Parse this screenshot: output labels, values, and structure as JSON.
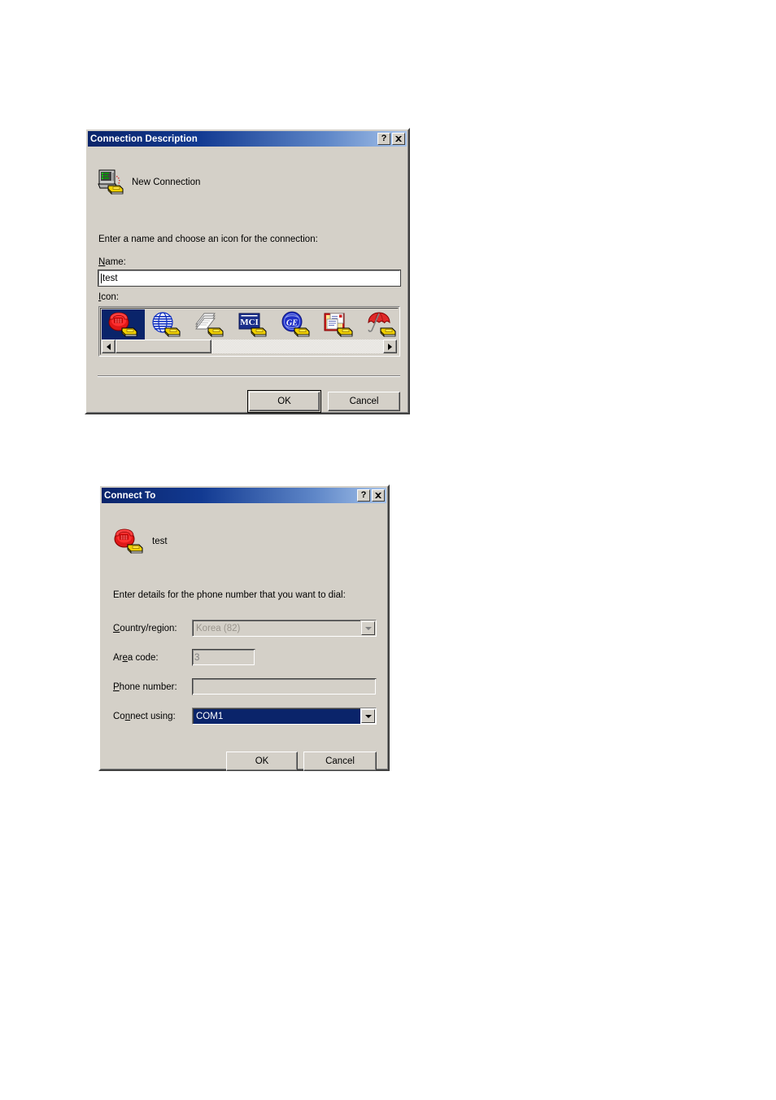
{
  "page": {
    "background": "#ffffff"
  },
  "dialogs": [
    {
      "id": "connection-description",
      "title": "Connection Description",
      "titlebar_buttons": [
        {
          "name": "help-button",
          "glyph": "?"
        },
        {
          "name": "close-button",
          "glyph": "×"
        }
      ],
      "header": {
        "icon": "new-connection-icon",
        "caption": "New Connection"
      },
      "prompt": "Enter a name and choose an icon for the connection:",
      "name_field": {
        "label": "Name:",
        "label_accelerator": "N",
        "value": "test",
        "placeholder": ""
      },
      "icon_field": {
        "label": "Icon:",
        "label_accelerator": "I",
        "selected_index": 0,
        "icons": [
          {
            "name": "red-telephone-modem-icon",
            "label": "Red telephone"
          },
          {
            "name": "blue-globe-modem-icon",
            "label": "Blue globe"
          },
          {
            "name": "fax-pages-modem-icon",
            "label": "Fax pages"
          },
          {
            "name": "mci-modem-icon",
            "label": "MCI"
          },
          {
            "name": "ge-globe-modem-icon",
            "label": "GE globe"
          },
          {
            "name": "documents-folder-modem-icon",
            "label": "Documents"
          },
          {
            "name": "umbrella-modem-icon",
            "label": "Umbrella"
          }
        ],
        "scrollbar": {
          "left_arrow": "◄",
          "right_arrow": "►",
          "thumb_fraction": 0.36
        }
      },
      "buttons": [
        {
          "name": "ok-button",
          "label": "OK",
          "default": true
        },
        {
          "name": "cancel-button",
          "label": "Cancel",
          "default": false
        }
      ]
    },
    {
      "id": "connect-to",
      "title": "Connect To",
      "titlebar_buttons": [
        {
          "name": "help-button",
          "glyph": "?"
        },
        {
          "name": "close-button",
          "glyph": "×"
        }
      ],
      "header": {
        "icon": "red-telephone-modem-icon",
        "caption": "test"
      },
      "prompt": "Enter details for the phone number that you want to dial:",
      "fields": [
        {
          "name": "country-region",
          "label": "Country/region:",
          "label_accelerator": "C",
          "type": "combo",
          "value": "Korea (82)",
          "disabled": true,
          "selected": false
        },
        {
          "name": "area-code",
          "label": "Area code:",
          "label_accelerator": "e",
          "type": "text",
          "value": "3",
          "disabled": true,
          "selected": false
        },
        {
          "name": "phone-number",
          "label": "Phone number:",
          "label_accelerator": "P",
          "type": "text",
          "value": "",
          "disabled": false,
          "selected": false
        },
        {
          "name": "connect-using",
          "label": "Connect using:",
          "label_accelerator": "n",
          "type": "combo",
          "value": "COM1",
          "disabled": false,
          "selected": true
        }
      ],
      "buttons": [
        {
          "name": "ok-button",
          "label": "OK",
          "default": false
        },
        {
          "name": "cancel-button",
          "label": "Cancel",
          "default": false
        }
      ]
    }
  ],
  "colors": {
    "dialog_face": "#d4d0c8",
    "titlebar_start": "#0a246a",
    "titlebar_end": "#a6c3ea",
    "highlight": "#0a246a",
    "disabled_text": "#808080",
    "window_white": "#ffffff"
  }
}
